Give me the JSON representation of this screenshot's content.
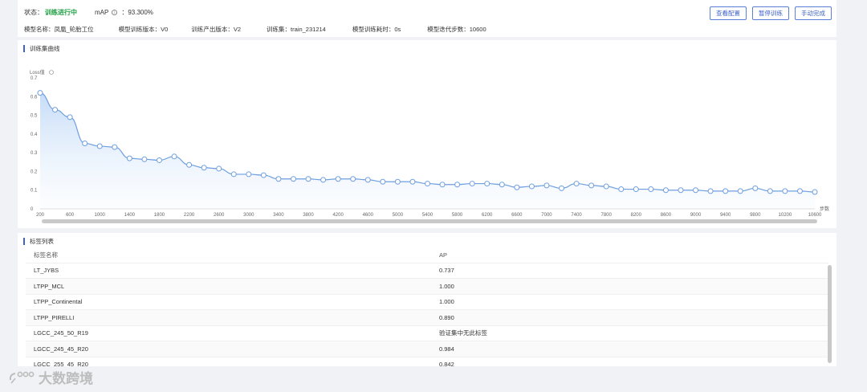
{
  "header": {
    "status_label": "状态：",
    "status_value": "训练进行中",
    "map_label": "mAP",
    "map_value": "：93.300%",
    "info": [
      "模型名称：",
      "凤凰_轮胎工位",
      "模型训练版本：V0",
      "训练产出版本：V2",
      "训练集：train_231214",
      "模型训练耗时：0s",
      "模型迭代步数：10600"
    ],
    "buttons": [
      "查看配置",
      "暂停训练",
      "手动完成"
    ]
  },
  "chart_section": {
    "title": "训练集曲线"
  },
  "chart_data": {
    "type": "area",
    "ylabel": "Loss值",
    "xlabel": "步数",
    "ylim": [
      0,
      0.7
    ],
    "yticks": [
      0,
      0.1,
      0.2,
      0.3,
      0.4,
      0.5,
      0.6,
      0.7
    ],
    "xticks": [
      200,
      600,
      1000,
      1400,
      1800,
      2200,
      2600,
      3000,
      3400,
      3800,
      4200,
      4600,
      5000,
      5400,
      5800,
      6200,
      6600,
      7000,
      7400,
      7800,
      8200,
      8600,
      9000,
      9400,
      9800,
      10200,
      10600
    ],
    "x": [
      200,
      400,
      600,
      800,
      1000,
      1200,
      1400,
      1600,
      1800,
      2000,
      2200,
      2400,
      2600,
      2800,
      3000,
      3200,
      3400,
      3600,
      3800,
      4000,
      4200,
      4400,
      4600,
      4800,
      5000,
      5200,
      5400,
      5600,
      5800,
      6000,
      6200,
      6400,
      6600,
      6800,
      7000,
      7200,
      7400,
      7600,
      7800,
      8000,
      8200,
      8400,
      8600,
      8800,
      9000,
      9200,
      9400,
      9600,
      9800,
      10000,
      10200,
      10400,
      10600
    ],
    "values": [
      0.62,
      0.53,
      0.49,
      0.35,
      0.335,
      0.33,
      0.27,
      0.265,
      0.26,
      0.28,
      0.235,
      0.22,
      0.215,
      0.185,
      0.185,
      0.18,
      0.16,
      0.16,
      0.16,
      0.155,
      0.16,
      0.16,
      0.155,
      0.145,
      0.145,
      0.145,
      0.135,
      0.13,
      0.13,
      0.135,
      0.135,
      0.13,
      0.115,
      0.12,
      0.125,
      0.11,
      0.135,
      0.125,
      0.12,
      0.105,
      0.105,
      0.105,
      0.1,
      0.1,
      0.1,
      0.095,
      0.095,
      0.095,
      0.11,
      0.095,
      0.095,
      0.095,
      0.09
    ],
    "line_color": "#6f9fdf"
  },
  "table_section": {
    "title": "标签列表",
    "headers": [
      "标签名称",
      "AP"
    ],
    "rows": [
      [
        "LT_JYBS",
        "0.737"
      ],
      [
        "LTPP_MCL",
        "1.000"
      ],
      [
        "LTPP_Continental",
        "1.000"
      ],
      [
        "LTPP_PIRELLI",
        "0.890"
      ],
      [
        "LGCC_245_50_R19",
        "验证集中无此标签"
      ],
      [
        "LGCC_245_45_R20",
        "0.984"
      ],
      [
        "LGCC_255_45_R20",
        "0.842"
      ]
    ]
  },
  "watermark": "大数跨境"
}
